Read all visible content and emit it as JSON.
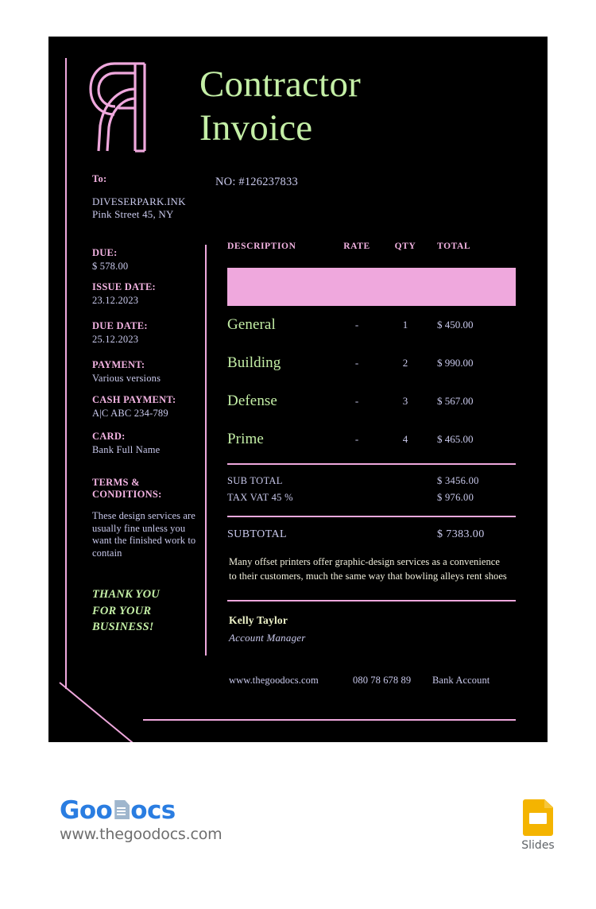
{
  "document": {
    "title": "Contractor\nInvoice",
    "logo_icon": "monogram-a-icon",
    "invoice_number": "NO: #126237833"
  },
  "recipient": {
    "label": "To:",
    "name": "DIVESERPARK.INK",
    "address": "Pink Street 45, NY"
  },
  "meta": [
    {
      "label": "DUE:",
      "value": "$ 578.00"
    },
    {
      "label": "ISSUE DATE:",
      "value": "23.12.2023"
    },
    {
      "label": "DUE DATE:",
      "value": "25.12.2023"
    },
    {
      "label": "PAYMENT:",
      "value": "Various versions"
    },
    {
      "label": "CASH PAYMENT:",
      "value": "A|C ABC 234-789"
    },
    {
      "label": "CARD:",
      "value": "Bank Full Name"
    }
  ],
  "terms": {
    "label": "TERMS &\nCONDITIONS:",
    "body": "These design services are usually fine unless you want the finished work to contain"
  },
  "thanks": "THANK YOU\nFOR YOUR\nBUSINESS!",
  "table": {
    "headers": {
      "description": "DESCRIPTION",
      "rate": "RATE",
      "qty": "QTY",
      "total": "TOTAL"
    },
    "rows": [
      {
        "description": "General",
        "rate": "-",
        "qty": "1",
        "total": "$ 450.00"
      },
      {
        "description": "Building",
        "rate": "-",
        "qty": "2",
        "total": "$ 990.00"
      },
      {
        "description": "Defense",
        "rate": "-",
        "qty": "3",
        "total": "$ 567.00"
      },
      {
        "description": "Prime",
        "rate": "-",
        "qty": "4",
        "total": "$ 465.00"
      }
    ]
  },
  "totals": {
    "sub_total_label": "SUB TOTAL",
    "sub_total_value": "$ 3456.00",
    "tax_label": "TAX VAT 45 %",
    "tax_value": "$ 976.00",
    "grand_label": "SUBTOTAL",
    "grand_value": "$ 7383.00"
  },
  "note": "Many offset printers offer graphic-design services as a convenience to their customers, much the same way that bowling alleys rent shoes",
  "signature": {
    "name": "Kelly Taylor",
    "role": "Account Manager"
  },
  "contacts": [
    "www.thegoodocs.com",
    "080 78 678 89",
    "Bank Account"
  ],
  "footer": {
    "brand_prefix": "Goo",
    "brand_suffix": "ocs",
    "brand_icon": "document-icon",
    "url": "www.thegoodocs.com",
    "app_label": "Slides",
    "app_icon": "google-slides-icon"
  },
  "colors": {
    "canvas": "#000000",
    "accent_pink": "#efa8dd",
    "label_pink": "#f3b3e2",
    "accent_green": "#c4efa6",
    "value_lavender": "#c9c9ec",
    "note_cream": "#f2f0dd",
    "brand_blue": "#2a7de1",
    "slides_yellow": "#f4b400"
  }
}
